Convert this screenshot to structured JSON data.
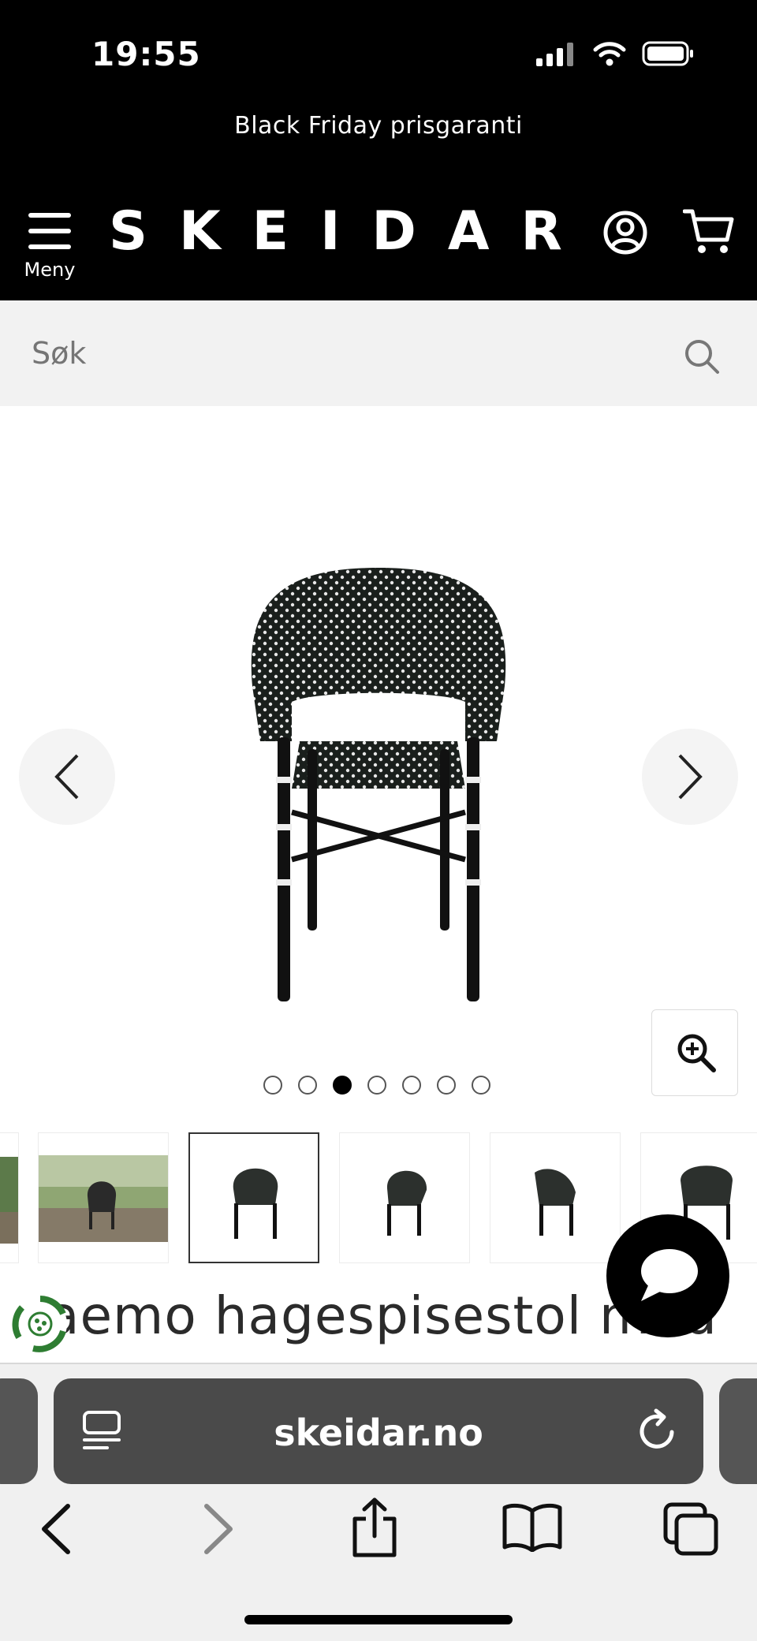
{
  "status": {
    "time": "19:55"
  },
  "promo": {
    "text": "Black Friday prisgaranti"
  },
  "header": {
    "menu_label": "Meny",
    "logo": "SKEIDAR"
  },
  "search": {
    "placeholder": "Søk"
  },
  "gallery": {
    "dot_count": 7,
    "active_index": 2
  },
  "product": {
    "title_visible": "aemo hagespisestol med"
  },
  "browser": {
    "url": "skeidar.no"
  },
  "colors": {
    "header_bg": "#000000",
    "search_bg": "#f2f2f2",
    "url_bar_bg": "#4a4a4a",
    "eco_green": "#2e7d32"
  }
}
